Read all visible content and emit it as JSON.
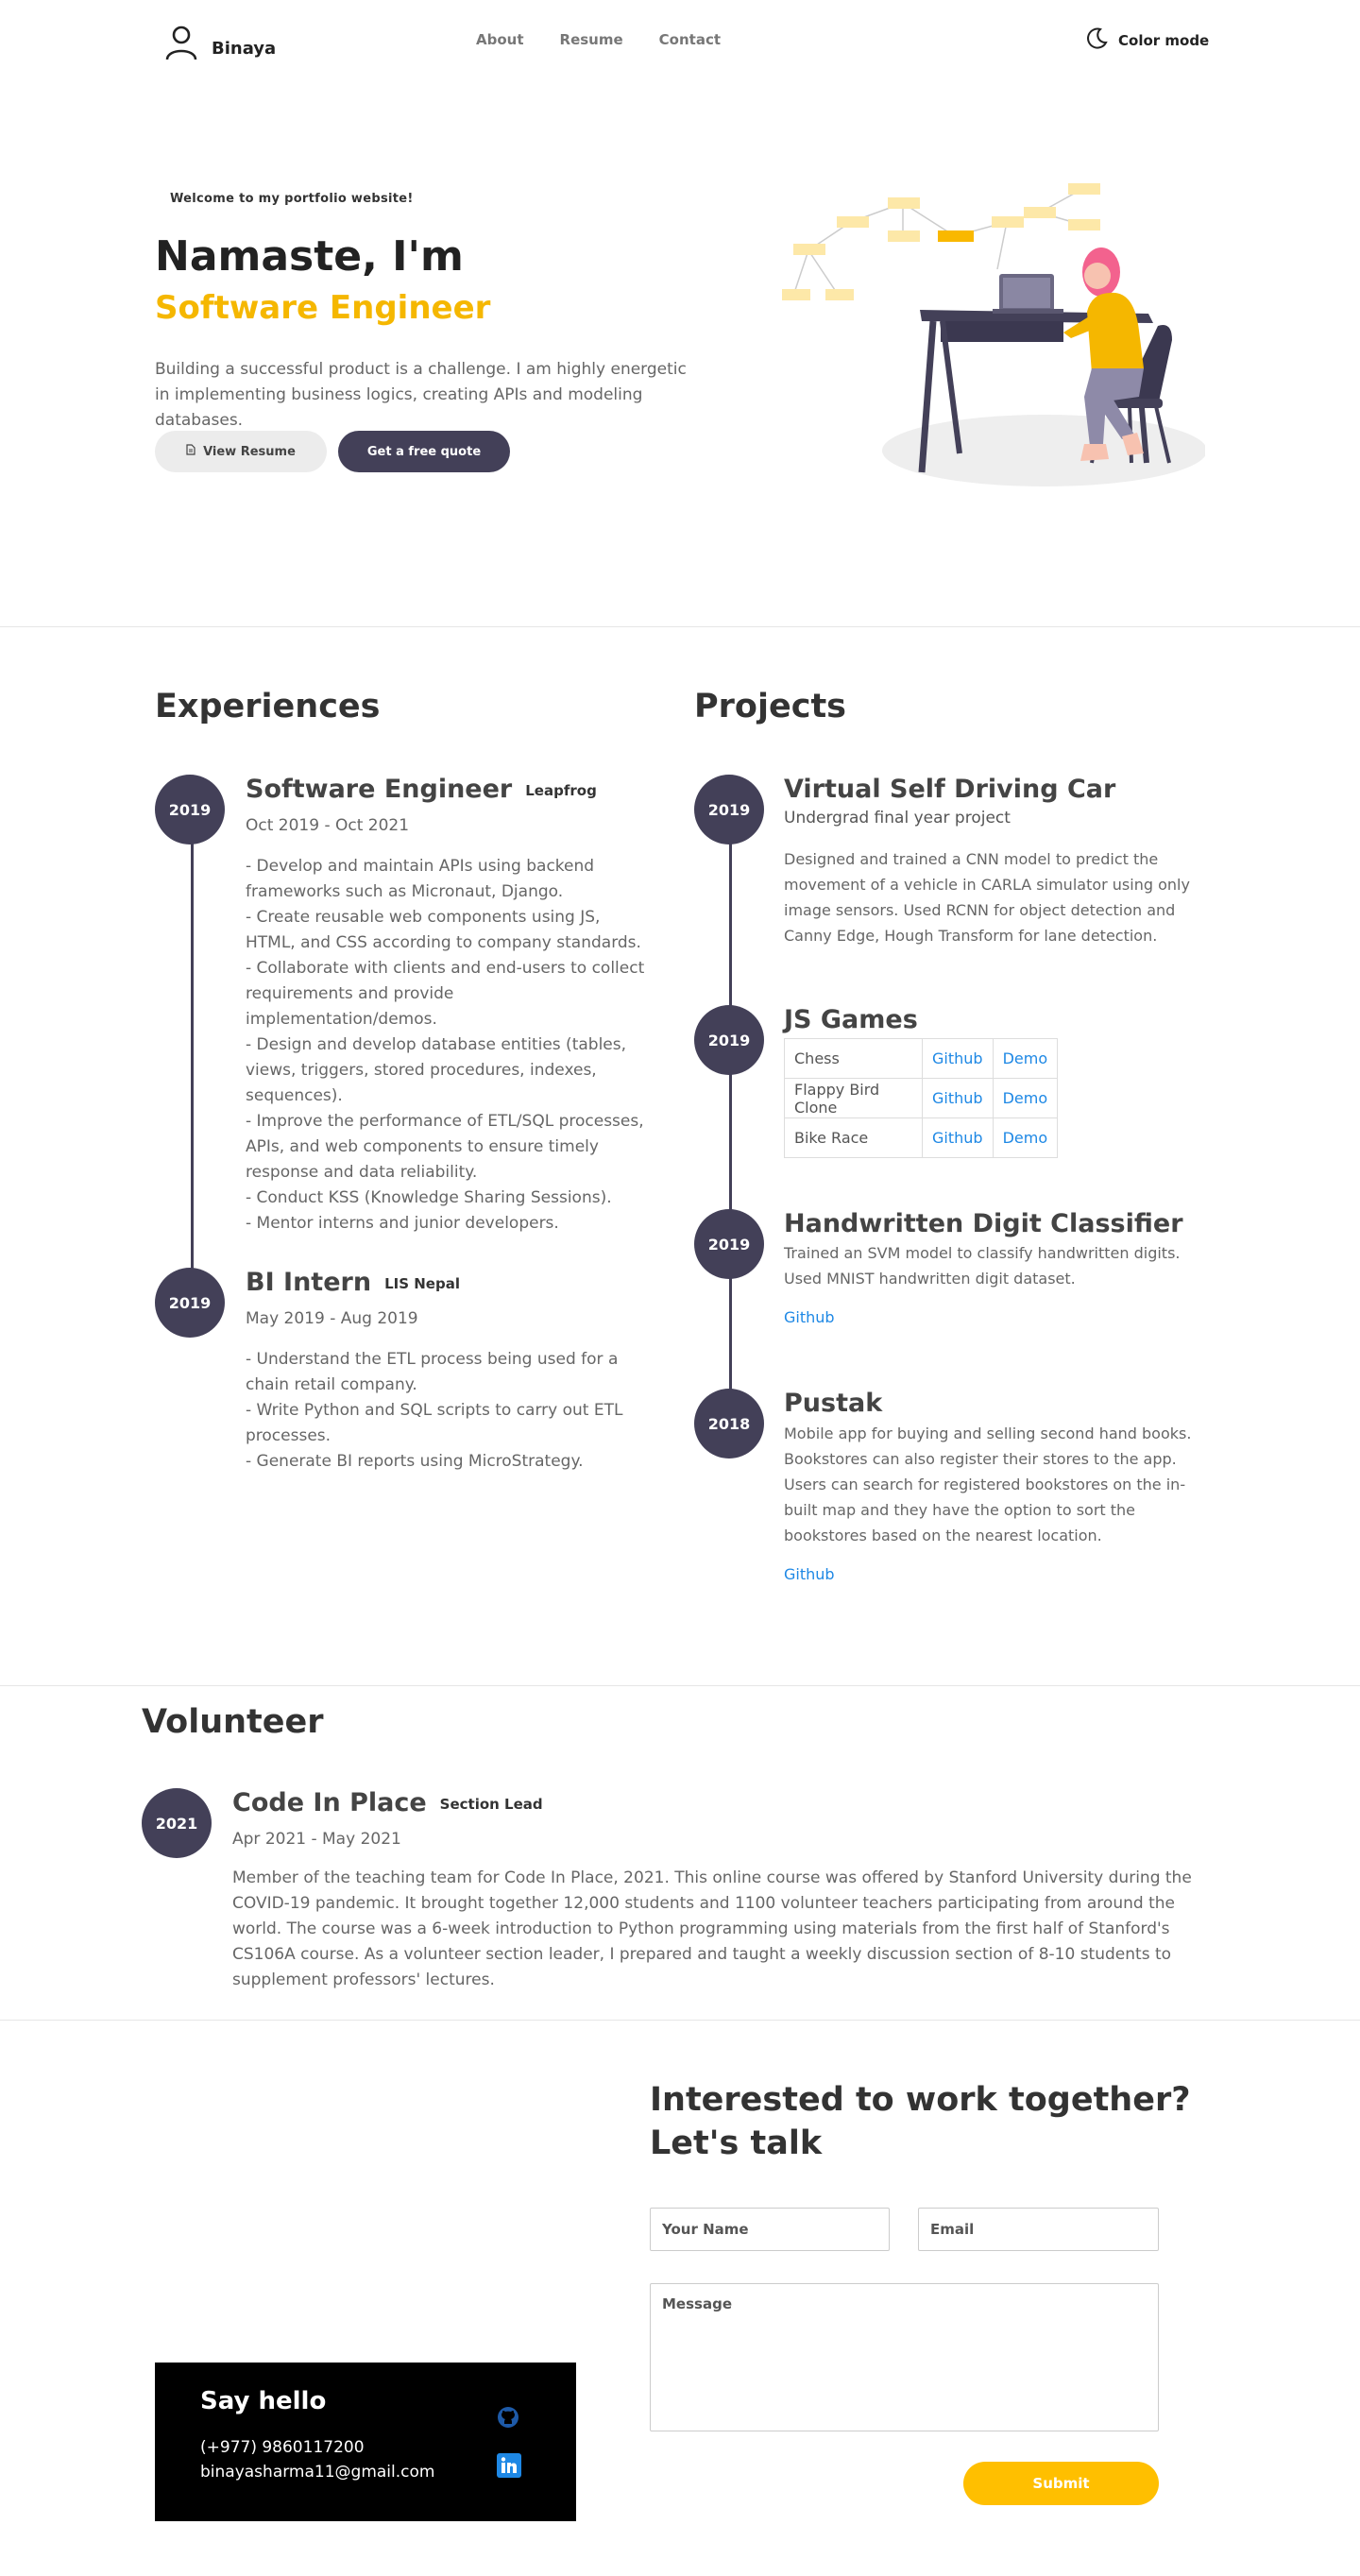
{
  "nav": {
    "brand": "Binaya",
    "links": [
      "About",
      "Resume",
      "Contact"
    ],
    "color_mode": "Color mode"
  },
  "hero": {
    "welcome": "Welcome to my portfolio website!",
    "title": "Namaste, I'm",
    "subtitle": "Software Engineer",
    "description": "Building a successful product is a challenge. I am highly energetic in implementing business logics, creating APIs and modeling databases.",
    "resume_button": "View Resume",
    "quote_button": "Get a free quote"
  },
  "experiences": {
    "title": "Experiences",
    "items": [
      {
        "year": "2019",
        "role": "Software Engineer",
        "company": "Leapfrog",
        "dates": "Oct 2019 - Oct 2021",
        "bullets": [
          "- Develop and maintain APIs using backend frameworks such as Micronaut, Django.",
          "- Create reusable web components using JS, HTML, and CSS according to company standards.",
          "- Collaborate with clients and end-users to collect requirements and provide implementation/demos.",
          "- Design and develop database entities (tables, views, triggers, stored procedures, indexes, sequences).",
          "- Improve the performance of ETL/SQL processes, APIs, and web components to ensure timely response and data reliability.",
          "- Conduct KSS (Knowledge Sharing Sessions).",
          "- Mentor interns and junior developers."
        ]
      },
      {
        "year": "2019",
        "role": "BI Intern",
        "company": "LIS Nepal",
        "dates": "May 2019 - Aug 2019",
        "bullets": [
          "- Understand the ETL process being used for a chain retail company.",
          "- Write Python and SQL scripts to carry out ETL processes.",
          "- Generate BI reports using MicroStrategy."
        ]
      }
    ]
  },
  "projects": {
    "title": "Projects",
    "items": [
      {
        "year": "2019",
        "name": "Virtual Self Driving Car",
        "subtitle": "Undergrad final year project",
        "description": "Designed and trained a CNN model to predict the movement of a vehicle in CARLA simulator using only image sensors. Used RCNN for object detection and Canny Edge, Hough Transform for lane detection."
      },
      {
        "year": "2019",
        "name": "JS Games",
        "games": [
          {
            "name": "Chess",
            "github": "Github",
            "demo": "Demo"
          },
          {
            "name": "Flappy Bird Clone",
            "github": "Github",
            "demo": "Demo"
          },
          {
            "name": "Bike Race",
            "github": "Github",
            "demo": "Demo"
          }
        ]
      },
      {
        "year": "2019",
        "name": "Handwritten Digit Classifier",
        "description": "Trained an SVM model to classify handwritten digits. Used MNIST handwritten digit dataset.",
        "link": "Github"
      },
      {
        "year": "2018",
        "name": "Pustak",
        "description": "Mobile app for buying and selling second hand books. Bookstores can also register their stores to the app. Users can search for registered bookstores on the in-built map and they have the option to sort the bookstores based on the nearest location.",
        "link": "Github"
      }
    ]
  },
  "volunteer": {
    "title": "Volunteer",
    "year": "2021",
    "name": "Code In Place",
    "role": "Section Lead",
    "dates": "Apr 2021 - May 2021",
    "description": "Member of the teaching team for Code In Place, 2021. This online course was offered by Stanford University during the COVID-19 pandemic. It brought together 12,000 students and 1100 volunteer teachers participating from around the world. The course was a 6-week introduction to Python programming using materials from the first half of Stanford's CS106A course. As a volunteer section leader, I prepared and taught a weekly discussion section of 8-10 students to supplement professors' lectures."
  },
  "contact": {
    "title_line1": "Interested to work together?",
    "title_line2": "Let's talk",
    "name_placeholder": "Your Name",
    "email_placeholder": "Email",
    "message_placeholder": "Message",
    "submit": "Submit",
    "hello_title": "Say hello",
    "phone": "(+977) 9860117200",
    "email": "binayasharma11@gmail.com"
  },
  "colors": {
    "accent": "#f5b700",
    "dark": "#434058",
    "link": "#1e88e5"
  },
  "icons": [
    "user-icon",
    "moon-icon",
    "document-icon",
    "github-icon",
    "linkedin-icon"
  ]
}
